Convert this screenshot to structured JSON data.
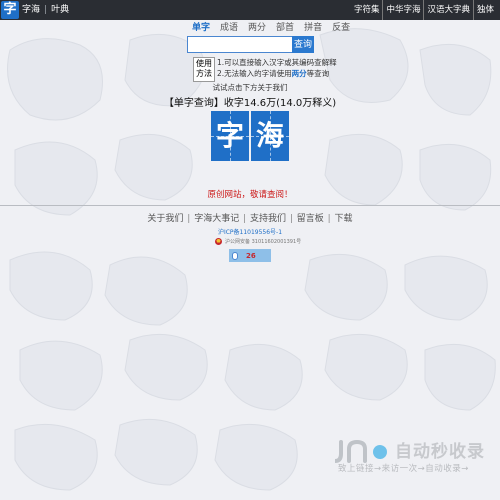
{
  "header": {
    "logo_char": "字",
    "site_name": "字海",
    "site_sub": "叶典",
    "links": [
      "字符集",
      "中华字海",
      "汉语大字典",
      "独体"
    ]
  },
  "search": {
    "tabs": [
      "单字",
      "成语",
      "两分",
      "部首",
      "拼音",
      "反查"
    ],
    "active_tab": "单字",
    "input_value": "",
    "button_label": "查询"
  },
  "usage": {
    "box_label_line1": "使用",
    "box_label_line2": "方法",
    "line1": "1.可以直接输入汉字或其编码查解释",
    "line2_prefix": "2.无法输入的字请使用",
    "line2_highlight": "两分",
    "line2_suffix": "等查询"
  },
  "about_tip": "试试点击下方关于我们",
  "headline": "【单字查询】收字14.6万(14.0万释义)",
  "big_logo": [
    "字",
    "海"
  ],
  "original_note": "原创网站，敬请查阅！",
  "footer": {
    "links": [
      "关于我们",
      "字海大事记",
      "支持我们",
      "留言板",
      "下载"
    ],
    "icp": "沪ICP备11019556号-1",
    "police": "沪公网安备 31011602001391号",
    "counter_value": "26"
  },
  "watermark": {
    "title": "自动秒收录",
    "subtitle": "致上链接→来访一次→自动收录→"
  },
  "colors": {
    "accent": "#1f6fc7",
    "topbar": "#2a2d33",
    "note_red": "#cc1a1a",
    "background": "#eff0f4"
  }
}
